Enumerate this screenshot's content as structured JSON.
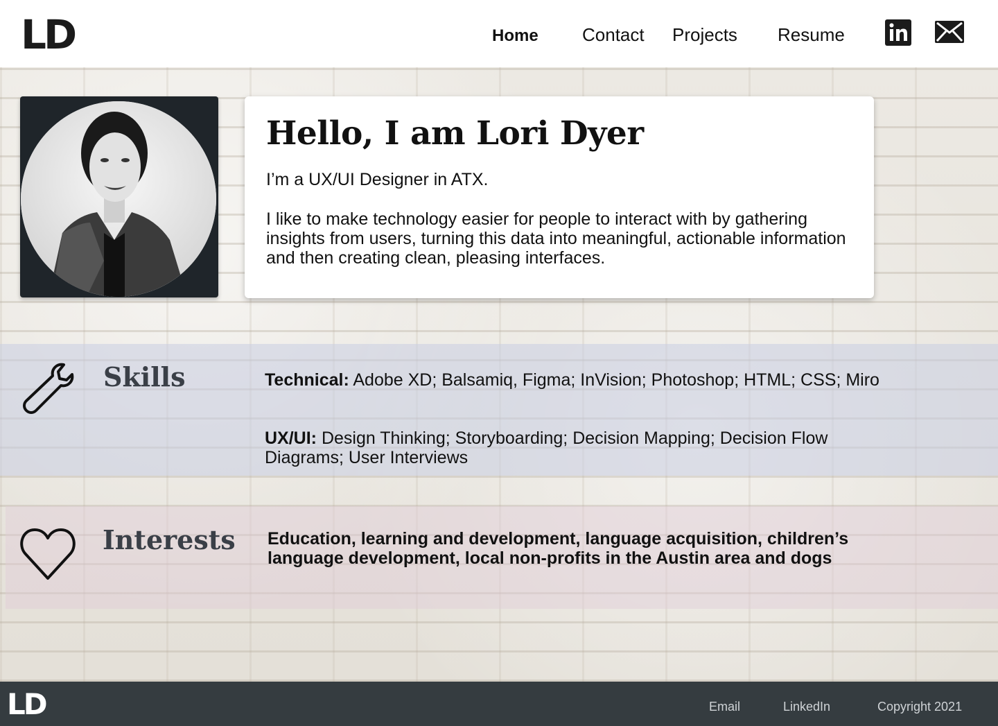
{
  "header": {
    "logo": "LD",
    "nav": [
      "Home",
      "Contact",
      "Projects",
      "Resume"
    ],
    "active_nav": "Home",
    "icons": [
      "linkedin-icon",
      "mail-icon"
    ]
  },
  "intro": {
    "title": "Hello, I am Lori Dyer",
    "subtitle": "I’m a UX/UI Designer in ATX.",
    "body": "I like to make technology easier for people to interact with by gathering insights from users, turning this data into meaningful, actionable information and then creating clean, pleasing interfaces."
  },
  "skills": {
    "title": "Skills",
    "technical_label": "Technical:",
    "technical_value": " Adobe XD; Balsamiq, Figma; InVision; Photoshop; HTML; CSS; Miro",
    "uxui_label": "UX/UI:",
    "uxui_value": " Design Thinking; Storyboarding; Decision Mapping; Decision Flow Diagrams; User Interviews"
  },
  "interests": {
    "title": "Interests",
    "text": "Education, learning and development, language acquisition, children’s language development, local non-profits in the Austin area and dogs"
  },
  "footer": {
    "logo": "LD",
    "links": [
      "Email",
      "LinkedIn"
    ],
    "copyright": "Copyright 2021"
  },
  "colors": {
    "footer_bg": "#353c40",
    "photo_card_bg": "#1f252a",
    "skills_band": "#c8cde1",
    "interests_band": "#e1cdd7"
  }
}
